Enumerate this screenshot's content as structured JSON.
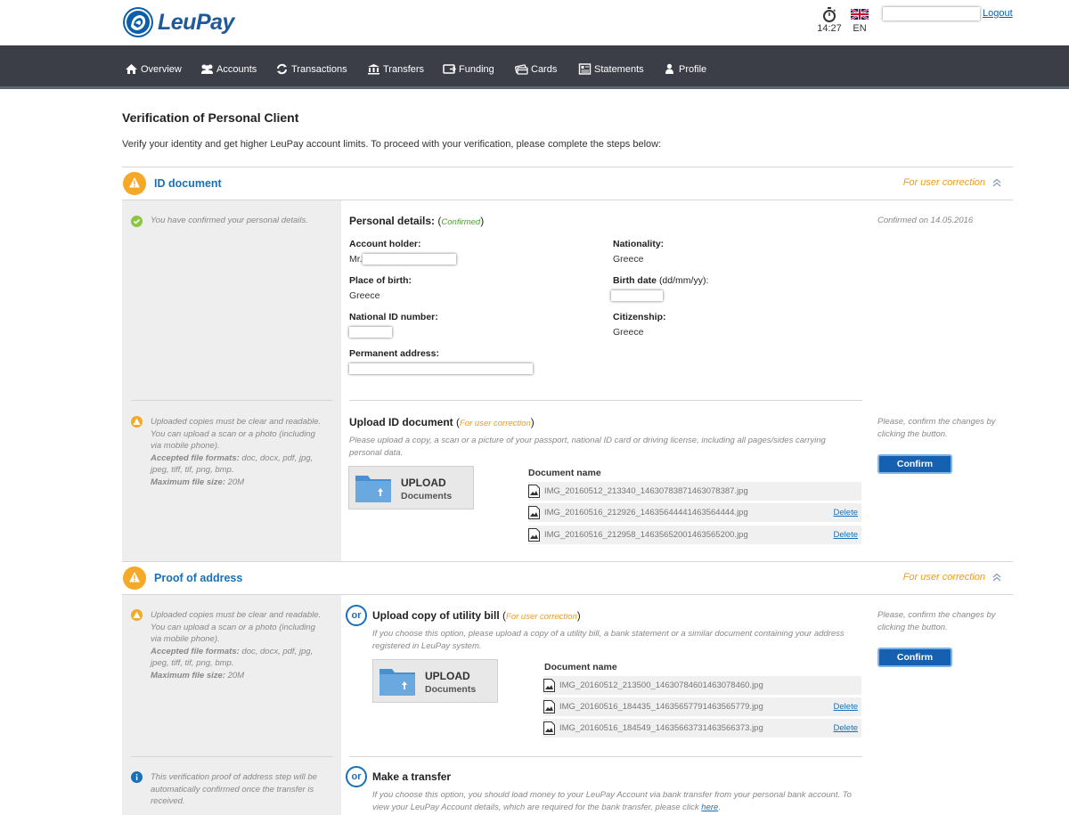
{
  "header": {
    "brand": "LeuPay",
    "time": "14:27",
    "language": "EN",
    "logout_label": "Logout"
  },
  "nav": [
    {
      "label": "Overview",
      "icon": "home-icon"
    },
    {
      "label": "Accounts",
      "icon": "users-icon"
    },
    {
      "label": "Transactions",
      "icon": "refresh-icon"
    },
    {
      "label": "Transfers",
      "icon": "bank-icon"
    },
    {
      "label": "Funding",
      "icon": "funding-icon"
    },
    {
      "label": "Cards",
      "icon": "cards-icon"
    },
    {
      "label": "Statements",
      "icon": "statements-icon"
    },
    {
      "label": "Profile",
      "icon": "profile-icon"
    }
  ],
  "page": {
    "title": "Verification of Personal Client",
    "intro": "Verify your identity and get higher LeuPay account limits. To proceed with your verification, please complete the steps below:"
  },
  "id_section": {
    "title": "ID document",
    "status": "For user correction",
    "confirmed_note": "You have confirmed your personal details.",
    "personal_title": "Personal details:",
    "personal_tag": "Confirmed",
    "confirmed_on": "Confirmed on 14.05.2016",
    "fields": {
      "account_holder_label": "Account holder:",
      "account_holder_prefix": "Mr.",
      "nationality_label": "Nationality:",
      "nationality_value": "Greece",
      "place_of_birth_label": "Place of birth:",
      "place_of_birth_value": "Greece",
      "birth_date_label": "Birth date",
      "birth_date_hint": "(dd/mm/yy):",
      "national_id_label": "National ID number:",
      "citizenship_label": "Citizenship:",
      "citizenship_value": "Greece",
      "permanent_address_label": "Permanent address:"
    },
    "upload_note": {
      "line1": "Uploaded copies must be clear and readable.",
      "line2": "You can upload a scan or a photo (including",
      "line3": "via mobile phone).",
      "formats_label": "Accepted file formats:",
      "formats_value": "doc, docx, pdf, jpg,",
      "formats_value2": "jpeg, tiff, tif, png, bmp.",
      "size_label": "Maximum file size:",
      "size_value": "20M"
    },
    "upload_title": "Upload ID document",
    "upload_tag": "For user correction",
    "upload_desc1": "Please upload a copy, a scan or a picture of your passport, national ID card or driving license, including all pages/sides carrying",
    "upload_desc2": "personal data.",
    "upload_btn1": "UPLOAD",
    "upload_btn2": "Documents",
    "doc_header": "Document name",
    "documents": [
      {
        "name": "IMG_20160512_213340_1463078387146307838​7.jpg",
        "delete": ""
      },
      {
        "name": "IMG_20160516_212926_1463564444146356444​4.jpg",
        "delete": "Delete"
      },
      {
        "name": "IMG_20160516_212958_1463565200146356520​0.jpg",
        "delete": "Delete"
      }
    ],
    "confirm_note1": "Please, confirm the changes by",
    "confirm_note2": "clicking the button.",
    "confirm_label": "Confirm"
  },
  "address_section": {
    "title": "Proof of address",
    "status": "For user correction",
    "upload_note": {
      "line1": "Uploaded copies must be clear and readable.",
      "line2": "You can upload a scan or a photo (including",
      "line3": "via mobile phone).",
      "formats_label": "Accepted file formats:",
      "formats_value": "doc, docx, pdf, jpg,",
      "formats_value2": "jpeg, tiff, tif, png, bmp.",
      "size_label": "Maximum file size:",
      "size_value": "20M"
    },
    "or_label": "or",
    "upload_title": "Upload copy of utility bill",
    "upload_tag": "For user correction",
    "upload_desc1": "If you choose this option, please upload a copy of a utility bill, a bank statement or a similar document containing your address",
    "upload_desc2": "registered in LeuPay system.",
    "upload_btn1": "UPLOAD",
    "upload_btn2": "Documents",
    "doc_header": "Document name",
    "documents": [
      {
        "name": "IMG_20160512_213500_1463078460146307846​0.jpg",
        "delete": ""
      },
      {
        "name": "IMG_20160516_184435_1463565779146356577​9.jpg",
        "delete": "Delete"
      },
      {
        "name": "IMG_20160516_184549_1463566373146356637​3.jpg",
        "delete": "Delete"
      }
    ],
    "confirm_note1": "Please, confirm the changes by",
    "confirm_note2": "clicking the button.",
    "confirm_label": "Confirm",
    "transfer_note1": "This verification proof of address step will be",
    "transfer_note2": "automatically confirmed once the transfer is",
    "transfer_note3": "received.",
    "transfer_title": "Make a transfer",
    "transfer_desc1": "If you choose this option, you should load money to your LeuPay Account via bank transfer from your personal bank account. To",
    "transfer_desc2": "view your LeuPay Account details, which are required for the bank transfer, please click",
    "transfer_link": "here",
    "transfer_desc_end": "."
  }
}
